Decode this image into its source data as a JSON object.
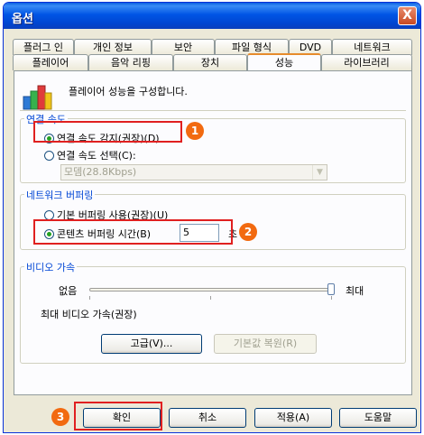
{
  "window": {
    "title": "옵션",
    "close_label": "X"
  },
  "tabs_back": [
    "플러그 인",
    "개인 정보",
    "보안",
    "파일 형식",
    "DVD",
    "네트워크"
  ],
  "tabs_front": [
    "플레이어",
    "음악 리핑",
    "장치",
    "성능",
    "라이브러리"
  ],
  "active_tab": "성능",
  "description": "플레이어 성능을 구성합니다.",
  "connection": {
    "group_title": "연결 속도",
    "auto_label": "연결 속도 감지(권장)(D)",
    "manual_label": "연결 속도 선택(C):",
    "speed_value": "모뎀(28.8Kbps)",
    "selected": "auto"
  },
  "buffering": {
    "group_title": "네트워크 버퍼링",
    "default_label": "기본 버퍼링 사용(권장)(U)",
    "custom_label": "콘텐츠 버퍼링 시간(B)",
    "seconds_value": "5",
    "unit": "초",
    "selected": "custom"
  },
  "video": {
    "group_title": "비디오 가속",
    "min_label": "없음",
    "max_label": "최대",
    "level": 1.0,
    "status": "최대 비디오 가속(권장)",
    "advanced_button": "고급(V)...",
    "restore_button": "기본값 복원(R)"
  },
  "footer": {
    "ok": "확인",
    "cancel": "취소",
    "apply": "적용(A)",
    "help": "도움말"
  },
  "callouts": [
    "1",
    "2",
    "3"
  ],
  "colors": {
    "highlight": "#e02020",
    "badge": "#f26a10",
    "group_title": "#0046d5"
  }
}
